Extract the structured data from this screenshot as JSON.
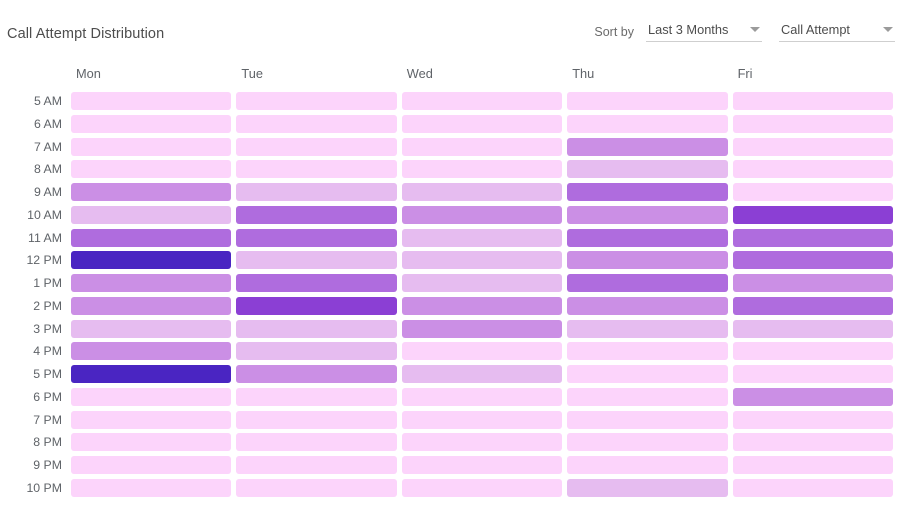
{
  "header": {
    "title": "Call Attempt Distribution",
    "sort_label": "Sort by",
    "dropdowns": [
      {
        "name": "period",
        "value": "Last 3 Months",
        "caret": "chevron-down-icon"
      },
      {
        "name": "metric",
        "value": "Call Attempt",
        "caret": "chevron-down-icon"
      }
    ]
  },
  "colors": {
    "background": "#ffffff",
    "title_text": "#4d4d4d",
    "axis_text": "#5f6368",
    "scale": [
      "#fcd4fb",
      "#e6bcf0",
      "#cb8fe5",
      "#af6cde",
      "#8b3fd4",
      "#4a25c2"
    ]
  },
  "chart_data": {
    "type": "heatmap",
    "title": "Call Attempt Distribution",
    "xlabel": "",
    "ylabel": "",
    "grid": false,
    "legend": "none",
    "x_categories": [
      "Mon",
      "Tue",
      "Wed",
      "Thu",
      "Fri"
    ],
    "y_categories": [
      "5 AM",
      "6 AM",
      "7 AM",
      "8 AM",
      "9 AM",
      "10 AM",
      "11 AM",
      "12 PM",
      "1 PM",
      "2 PM",
      "3 PM",
      "4 PM",
      "5 PM",
      "6 PM",
      "7 PM",
      "8 PM",
      "9 PM",
      "10 PM"
    ],
    "zlim": [
      0,
      5
    ],
    "z_levels": [
      0,
      1,
      2,
      3,
      4,
      5
    ],
    "values": [
      [
        0,
        0,
        0,
        0,
        0
      ],
      [
        0,
        0,
        0,
        0,
        0
      ],
      [
        0,
        0,
        0,
        2,
        0
      ],
      [
        0,
        0,
        0,
        1,
        0
      ],
      [
        2,
        1,
        1,
        3,
        0
      ],
      [
        1,
        3,
        2,
        2,
        4
      ],
      [
        3,
        3,
        1,
        3,
        3
      ],
      [
        5,
        1,
        1,
        2,
        3
      ],
      [
        2,
        3,
        1,
        3,
        2
      ],
      [
        2,
        4,
        2,
        2,
        3
      ],
      [
        1,
        1,
        2,
        1,
        1
      ],
      [
        2,
        1,
        0,
        0,
        0
      ],
      [
        5,
        2,
        1,
        0,
        0
      ],
      [
        0,
        0,
        0,
        0,
        2
      ],
      [
        0,
        0,
        0,
        0,
        0
      ],
      [
        0,
        0,
        0,
        0,
        0
      ],
      [
        0,
        0,
        0,
        0,
        0
      ],
      [
        0,
        0,
        0,
        1,
        0
      ]
    ]
  }
}
